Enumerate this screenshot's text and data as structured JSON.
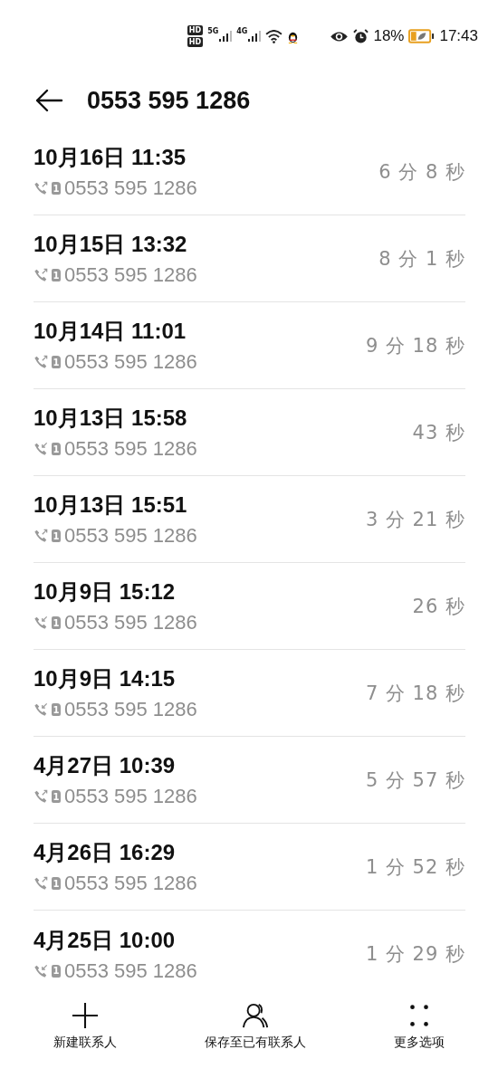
{
  "status_bar": {
    "sim_badges": [
      "HD",
      "HD"
    ],
    "networks": [
      "5G",
      "4G"
    ],
    "battery_text": "18%",
    "time": "17:43"
  },
  "header": {
    "title": "0553 595 1286"
  },
  "calls": [
    {
      "date": "10月16日 11:35",
      "incoming": false,
      "sim": "1",
      "number": "0553 595 1286",
      "duration": "6 分 8 秒"
    },
    {
      "date": "10月15日 13:32",
      "incoming": false,
      "sim": "1",
      "number": "0553 595 1286",
      "duration": "8 分 1 秒"
    },
    {
      "date": "10月14日 11:01",
      "incoming": false,
      "sim": "1",
      "number": "0553 595 1286",
      "duration": "9 分 18 秒"
    },
    {
      "date": "10月13日 15:58",
      "incoming": true,
      "sim": "1",
      "number": "0553 595 1286",
      "duration": "43 秒"
    },
    {
      "date": "10月13日 15:51",
      "incoming": false,
      "sim": "1",
      "number": "0553 595 1286",
      "duration": "3 分 21 秒"
    },
    {
      "date": "10月9日 15:12",
      "incoming": true,
      "sim": "1",
      "number": "0553 595 1286",
      "duration": "26 秒"
    },
    {
      "date": "10月9日 14:15",
      "incoming": true,
      "sim": "1",
      "number": "0553 595 1286",
      "duration": "7 分 18 秒"
    },
    {
      "date": "4月27日 10:39",
      "incoming": false,
      "sim": "1",
      "number": "0553 595 1286",
      "duration": "5 分 57 秒"
    },
    {
      "date": "4月26日 16:29",
      "incoming": false,
      "sim": "1",
      "number": "0553 595 1286",
      "duration": "1 分 52 秒"
    },
    {
      "date": "4月25日 10:00",
      "incoming": true,
      "sim": "1",
      "number": "0553 595 1286",
      "duration": "1 分 29 秒"
    }
  ],
  "actions": [
    {
      "kind": "add",
      "label": "新建联系人"
    },
    {
      "kind": "contact",
      "label": "保存至已有联系人"
    },
    {
      "kind": "more",
      "label": "更多选项"
    }
  ]
}
